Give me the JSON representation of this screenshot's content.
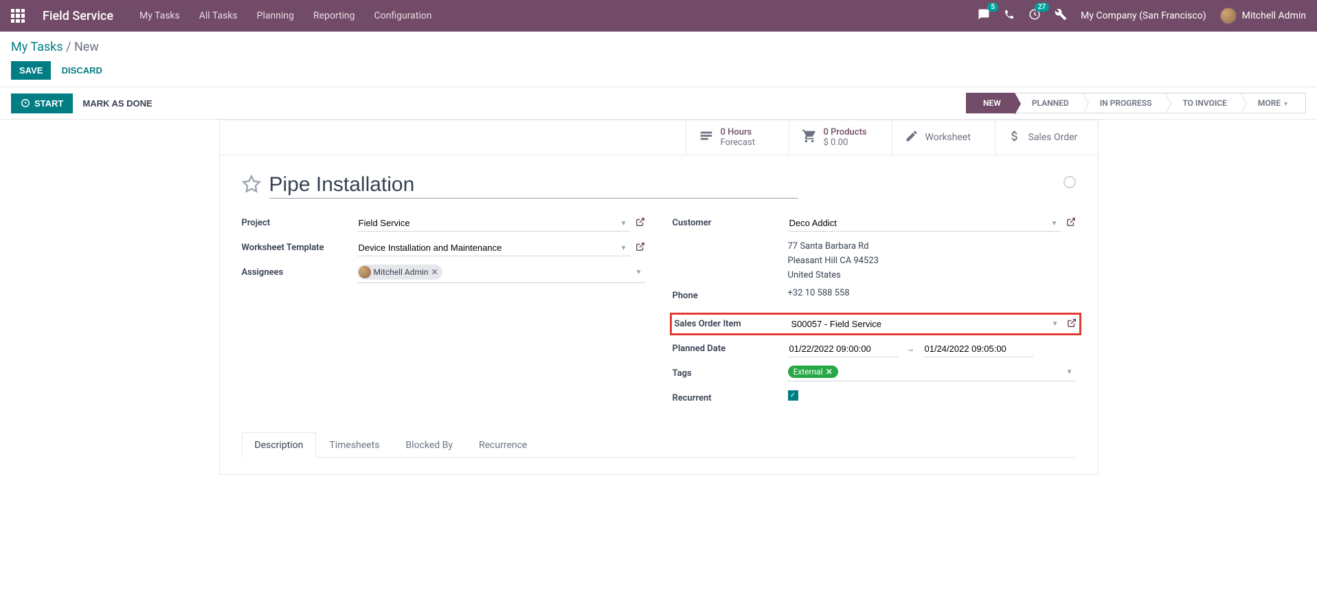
{
  "navbar": {
    "app_title": "Field Service",
    "menu": [
      "My Tasks",
      "All Tasks",
      "Planning",
      "Reporting",
      "Configuration"
    ],
    "messages_badge": "5",
    "activities_badge": "27",
    "company": "My Company (San Francisco)",
    "user": "Mitchell Admin"
  },
  "breadcrumb": {
    "parent": "My Tasks",
    "current": "New"
  },
  "buttons": {
    "save": "SAVE",
    "discard": "DISCARD",
    "start": "START",
    "mark_done": "MARK AS DONE"
  },
  "stages": [
    "NEW",
    "PLANNED",
    "IN PROGRESS",
    "TO INVOICE",
    "MORE"
  ],
  "active_stage": "NEW",
  "stat_buttons": {
    "hours": {
      "value": "0  Hours",
      "label": "Forecast"
    },
    "products": {
      "value": "0 Products",
      "label": "$ 0.00"
    },
    "worksheet": "Worksheet",
    "sales_order": "Sales Order"
  },
  "form": {
    "title": "Pipe Installation",
    "labels": {
      "project": "Project",
      "worksheet_template": "Worksheet Template",
      "assignees": "Assignees",
      "customer": "Customer",
      "phone": "Phone",
      "sales_order_item": "Sales Order Item",
      "planned_date": "Planned Date",
      "tags": "Tags",
      "recurrent": "Recurrent"
    },
    "values": {
      "project": "Field Service",
      "worksheet_template": "Device Installation and Maintenance",
      "assignee": "Mitchell Admin",
      "customer": "Deco Addict",
      "address_line1": "77 Santa Barbara Rd",
      "address_line2": "Pleasant Hill CA 94523",
      "address_country": "United States",
      "phone": "+32 10 588 558",
      "sales_order_item": "S00057 - Field Service",
      "planned_start": "01/22/2022 09:00:00",
      "planned_end": "01/24/2022 09:05:00",
      "tag": "External",
      "recurrent": true
    }
  },
  "tabs": [
    "Description",
    "Timesheets",
    "Blocked By",
    "Recurrence"
  ],
  "active_tab": "Description"
}
